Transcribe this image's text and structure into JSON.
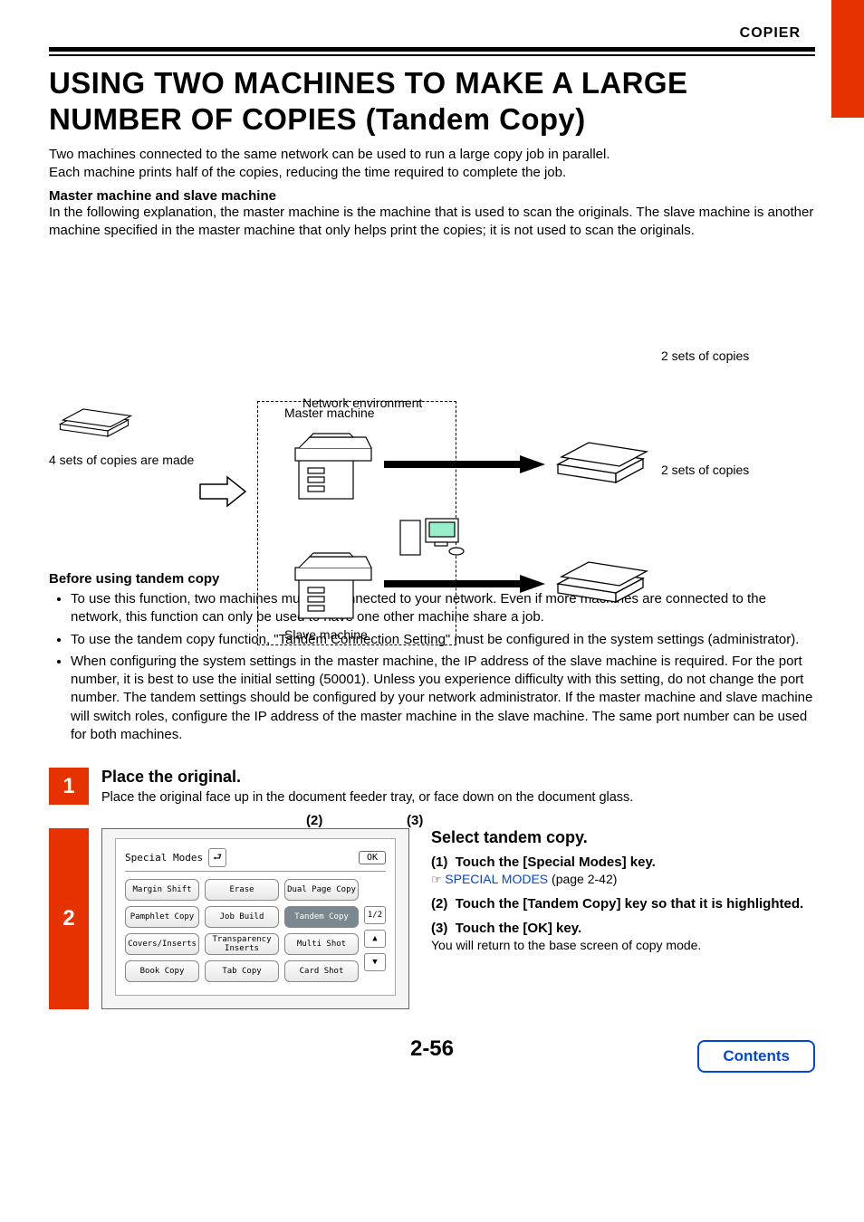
{
  "header": {
    "section": "COPIER"
  },
  "title": "USING TWO MACHINES TO MAKE A LARGE NUMBER OF COPIES (Tandem Copy)",
  "intro1": "Two machines connected to the same network can be used to run a large copy job in parallel.",
  "intro2": "Each machine prints half of the copies, reducing the time required to complete the job.",
  "sub1_title": "Master machine and slave machine",
  "sub1_text": "In the following explanation, the master machine is the machine that is used to scan the originals. The slave machine is another machine specified in the master machine that only helps print the copies; it is not used to scan the originals.",
  "diagram": {
    "master": "Master machine",
    "slave": "Slave machine",
    "network": "Network environment",
    "left_caption": "4 sets of copies are made",
    "right_upper": "2 sets of copies",
    "right_lower": "2 sets of copies"
  },
  "before_title": "Before using tandem copy",
  "bullets": [
    "To use this function, two machines must be connected to your network. Even if more machines are connected to the network, this function can only be used to have one other machine share a job.",
    "To use the tandem copy function, \"Tandem Connection Setting\" must be configured in the system settings (administrator).",
    "When configuring the system settings in the master machine, the IP address of the slave machine is required. For the port number, it is best to use the initial setting (50001). Unless you experience difficulty with this setting, do not change the port number. The tandem settings should be configured by your network administrator. If the master machine and slave machine will switch roles, configure the IP address of the master machine in the slave machine. The same port number can be used for both machines."
  ],
  "step1": {
    "num": "1",
    "title": "Place the original.",
    "desc": "Place the original face up in the document feeder tray, or face down on the document glass."
  },
  "step2": {
    "num": "2",
    "panel": {
      "title": "Special Modes",
      "ok": "OK",
      "callout2": "(2)",
      "callout3": "(3)",
      "page_frac_top": "1",
      "page_frac_bot": "2",
      "buttons": [
        "Margin Shift",
        "Erase",
        "Dual Page Copy",
        "Pamphlet Copy",
        "Job Build",
        "Tandem Copy",
        "Covers/Inserts",
        "Transparency Inserts",
        "Multi Shot",
        "Book Copy",
        "Tab Copy",
        "Card Shot"
      ]
    },
    "instr_title": "Select tandem copy.",
    "instr": [
      {
        "n": "(1)",
        "t": "Touch the [Special Modes] key.",
        "link_pre": "☞ ",
        "link": "SPECIAL MODES",
        "link_suf": " (page 2-42)"
      },
      {
        "n": "(2)",
        "t": "Touch the [Tandem Copy] key so that it is highlighted."
      },
      {
        "n": "(3)",
        "t": "Touch the [OK] key.",
        "sub": "You will return to the base screen of copy mode."
      }
    ]
  },
  "page_number": "2-56",
  "contents_label": "Contents"
}
